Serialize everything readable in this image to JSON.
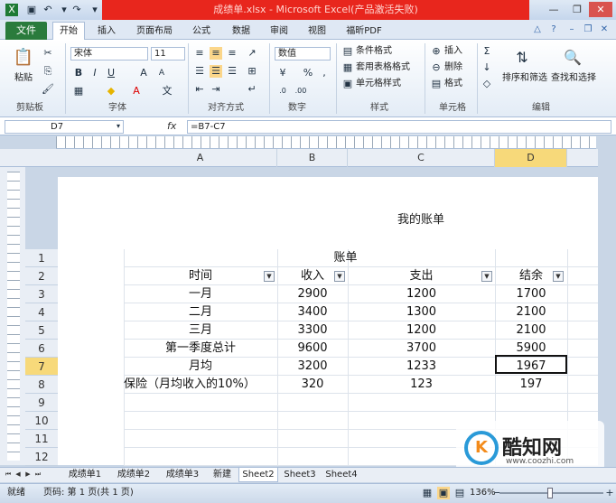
{
  "window": {
    "title": "成绩单.xlsx - Microsoft Excel(产品激活失败)"
  },
  "ribbon_tabs": [
    "文件",
    "开始",
    "插入",
    "页面布局",
    "公式",
    "数据",
    "审阅",
    "视图",
    "福昕PDF"
  ],
  "ribbon": {
    "paste": "粘贴",
    "font_name": "宋体",
    "font_size": "11",
    "number_format": "数值",
    "conditional_format": "条件格式",
    "table_format": "套用表格格式",
    "cell_style": "单元格样式",
    "insert": "插入",
    "delete": "删除",
    "format": "格式",
    "sort_filter": "排序和筛选",
    "find_select": "查找和选择",
    "groups": {
      "clipboard": "剪贴板",
      "font": "字体",
      "alignment": "对齐方式",
      "number": "数字",
      "styles": "样式",
      "cells": "单元格",
      "editing": "编辑"
    }
  },
  "formula_bar": {
    "name_box": "D7",
    "fx": "fx",
    "formula": "=B7-C7"
  },
  "columns": [
    "A",
    "B",
    "C",
    "D"
  ],
  "page_header": "我的账单",
  "rows": [
    "1",
    "2",
    "3",
    "4",
    "5",
    "6",
    "7",
    "8",
    "9",
    "10",
    "11",
    "12"
  ],
  "table": {
    "title": "账单",
    "headers": [
      "时间",
      "收入",
      "支出",
      "结余"
    ],
    "data": [
      [
        "一月",
        "2900",
        "1200",
        "1700"
      ],
      [
        "二月",
        "3400",
        "1300",
        "2100"
      ],
      [
        "三月",
        "3300",
        "1200",
        "2100"
      ],
      [
        "第一季度总计",
        "9600",
        "3700",
        "5900"
      ],
      [
        "月均",
        "3200",
        "1233",
        "1967"
      ],
      [
        "保险（月均收入的10%）",
        "320",
        "123",
        "197"
      ]
    ]
  },
  "sheet_tabs": [
    "成绩单1",
    "成绩单2",
    "成绩单3",
    "新建",
    "Sheet2",
    "Sheet3",
    "Sheet4"
  ],
  "status": {
    "ready": "就绪",
    "page": "页码: 第 1 页(共 1 页)",
    "zoom": "136%"
  },
  "watermark": {
    "logo": "K",
    "text": "酷知网",
    "url": "www.coozhi.com"
  }
}
